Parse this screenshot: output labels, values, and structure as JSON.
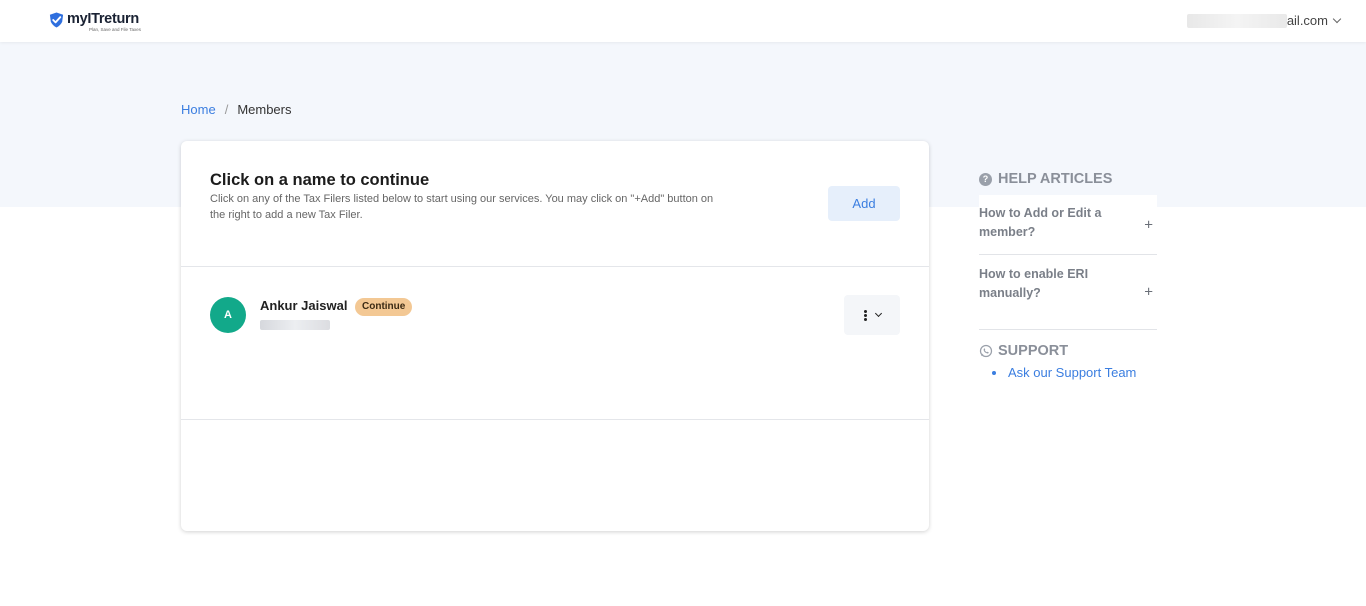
{
  "header": {
    "logo_name": "myITreturn",
    "logo_tagline": "Plan, Save and File Taxes",
    "account_email": "ail.com"
  },
  "breadcrumb": {
    "home": "Home",
    "separator": "/",
    "current": "Members"
  },
  "card": {
    "title": "Click on a name to continue",
    "description": "Click on any of the Tax Filers listed below to start using our services. You may click on \"+Add\" button on the right to add a new Tax Filer.",
    "add_label": "Add"
  },
  "members": [
    {
      "initial": "A",
      "name": "Ankur Jaiswal",
      "status": "Continue"
    }
  ],
  "sidebar": {
    "help_title": "HELP ARTICLES",
    "help_icon": "?",
    "articles": [
      {
        "question": "How to Add or Edit a member?",
        "toggle": "+"
      },
      {
        "question": "How to enable ERI manually?",
        "toggle": "+"
      }
    ],
    "support_title": "SUPPORT",
    "support_links": [
      "Ask our Support Team"
    ]
  },
  "colors": {
    "accent": "#3b7ee0",
    "avatar": "#12a98a",
    "badge": "#f3c894",
    "band": "#f4f7fc"
  }
}
